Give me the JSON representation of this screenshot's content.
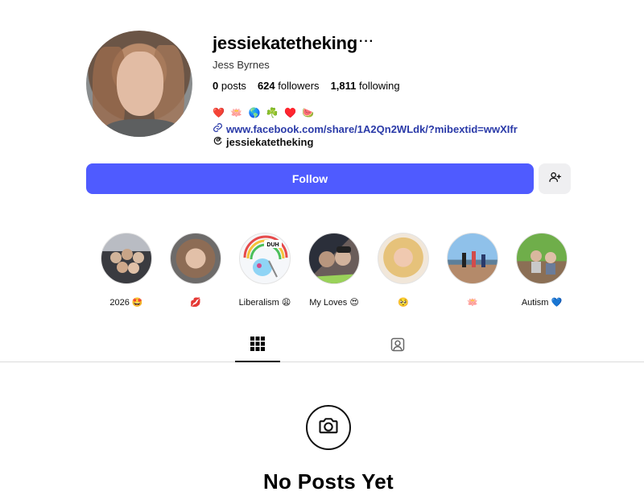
{
  "profile": {
    "username": "jessiekatetheking",
    "more_label": "···",
    "full_name": "Jess Byrnes",
    "stats": {
      "posts_count": "0",
      "posts_label": "posts",
      "followers_count": "624",
      "followers_label": "followers",
      "following_count": "1,811",
      "following_label": "following"
    },
    "bio_emoji": "❤️ 🪷 🌎 ☘️ ♥️ 🍉",
    "link": "www.facebook.com/share/1A2Qn2WLdk/?mibextid=wwXIfr",
    "threads_handle": "jessiekatetheking"
  },
  "actions": {
    "follow_label": "Follow"
  },
  "highlights": [
    {
      "label": "2026 🤩",
      "thumb": "group-icon"
    },
    {
      "label": "💋",
      "thumb": "selfie-icon"
    },
    {
      "label": "Liberalism 😩",
      "thumb": "pony-icon"
    },
    {
      "label": "My Loves 😍",
      "thumb": "couple-icon"
    },
    {
      "label": "🥺",
      "thumb": "doll-icon"
    },
    {
      "label": "🪷",
      "thumb": "beach-icon"
    },
    {
      "label": "Autism 💙",
      "thumb": "kids-icon"
    }
  ],
  "empty_state": {
    "title": "No Posts Yet"
  },
  "colors": {
    "follow_button": "#4f5bff",
    "link": "#2a3aa8",
    "secondary_button": "#efeff1"
  }
}
